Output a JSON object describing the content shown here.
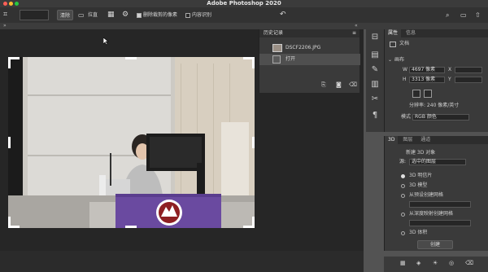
{
  "app": {
    "title": "Adobe Photoshop 2020"
  },
  "optionsbar": {
    "clear_label": "清除",
    "straighten_label": "拉直",
    "delete_cropped_label": "删除裁剪的像素",
    "content_aware_label": "内容识别"
  },
  "history": {
    "tab_label": "历史记录",
    "snapshot_name": "DSCF2206.JPG",
    "step_label": "打开"
  },
  "properties": {
    "tab_properties": "属性",
    "tab_info": "信息",
    "doc_label": "文档",
    "canvas_section": "画布",
    "w_label": "W",
    "w_value": "4697 像素",
    "x_label": "X",
    "h_label": "H",
    "h_value": "3313 像素",
    "y_label": "Y",
    "resolution": "分辨率: 240 像素/英寸",
    "mode_label": "模式",
    "mode_value": "RGB 颜色"
  },
  "threed": {
    "tab_3d": "3D",
    "tab_layers": "图层",
    "tab_channels": "通道",
    "new_object_label": "新建 3D 对象",
    "source_label": "源:",
    "source_value": "选中的图层",
    "options": [
      "3D 明信片",
      "3D 模型",
      "从预设创建网格",
      "从深度映射创建网格",
      "3D 体积"
    ],
    "create_label": "创建"
  },
  "colors": {
    "accent": "#1473e6"
  }
}
